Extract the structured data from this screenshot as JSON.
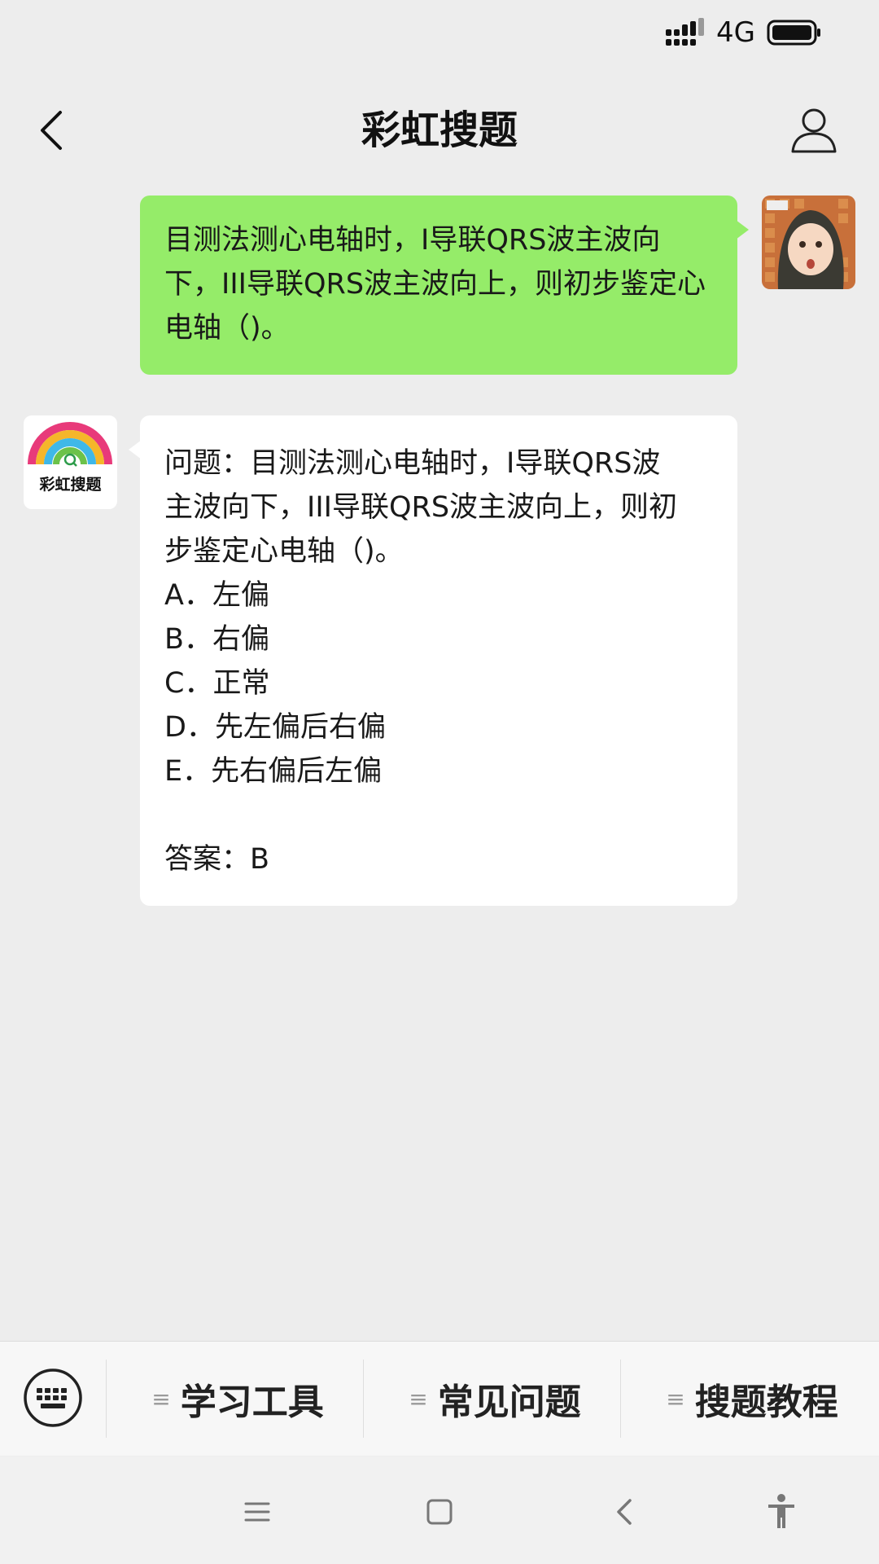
{
  "status_bar": {
    "network": "4G",
    "icons": [
      "signal-icon",
      "battery-icon"
    ]
  },
  "nav": {
    "title": "彩虹搜题",
    "icons": [
      "back-icon",
      "profile-icon"
    ]
  },
  "user_message": {
    "text": "目测法测心电轴时，I导联QRS波主波向下，III导联QRS波主波向上，则初步鉴定心电轴（)。",
    "bubble_color": "#95ec69"
  },
  "bot": {
    "avatar_label": "彩虹搜题",
    "question_lines": [
      "问题：目测法测心电轴时，I导联QRS波",
      "主波向下，III导联QRS波主波向上，则初",
      "步鉴定心电轴（)。"
    ],
    "options": [
      "A．左偏",
      "B．右偏",
      "C．正常",
      "D．先左偏后右偏",
      "E．先右偏后左偏"
    ],
    "answer": "答案：B"
  },
  "menu": {
    "items": [
      {
        "label": "学习工具",
        "icon": "menu-lines-icon"
      },
      {
        "label": "常见问题",
        "icon": "menu-lines-icon"
      },
      {
        "label": "搜题教程",
        "icon": "menu-lines-icon"
      }
    ],
    "keyboard_icon": "keyboard-icon"
  },
  "system_nav": {
    "icons": [
      "menu-icon",
      "home-icon",
      "back-arrow-icon",
      "accessibility-icon"
    ]
  },
  "colors": {
    "background": "#ededed",
    "user_bubble": "#95ec69",
    "bot_bubble": "#ffffff"
  }
}
